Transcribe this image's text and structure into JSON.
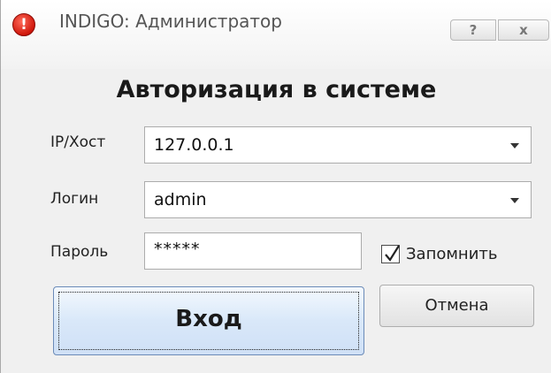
{
  "window": {
    "title": "INDIGO: Администратор",
    "help_label": "?",
    "close_label": "x"
  },
  "form": {
    "heading": "Авторизация в системе",
    "host_label": "IP/Хост",
    "host_value": "127.0.0.1",
    "login_label": "Логин",
    "login_value": "admin",
    "password_label": "Пароль",
    "password_value": "*****",
    "remember_label": "Запомнить",
    "remember_checked": true
  },
  "buttons": {
    "login_label": "Вход",
    "cancel_label": "Отмена"
  },
  "icons": {
    "app": "error-icon",
    "dropdown": "chevron-down-icon",
    "check": "check-icon"
  }
}
